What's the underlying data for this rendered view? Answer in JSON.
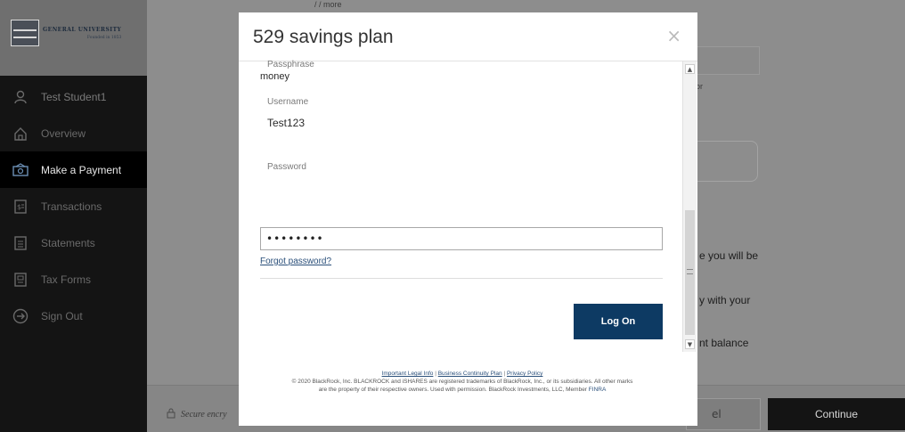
{
  "logo": {
    "name": "GENERAL UNIVERSITY",
    "sub": "Founded in 1853"
  },
  "sidebar": {
    "items": [
      {
        "label": "Test Student1",
        "icon": "user-icon"
      },
      {
        "label": "Overview",
        "icon": "home-icon"
      },
      {
        "label": "Make a Payment",
        "icon": "payment-icon"
      },
      {
        "label": "Transactions",
        "icon": "transactions-icon"
      },
      {
        "label": "Statements",
        "icon": "statements-icon"
      },
      {
        "label": "Tax Forms",
        "icon": "tax-forms-icon"
      },
      {
        "label": "Sign Out",
        "icon": "sign-out-icon"
      }
    ]
  },
  "background": {
    "top_text": "/ / more",
    "text_or": "or",
    "text_line1": "e you will be",
    "text_line2": "y with your",
    "text_line3": "nt balance",
    "secure_text": "Secure encry",
    "cancel_label": "el",
    "continue_label": "Continue"
  },
  "modal": {
    "title": "529 savings plan",
    "close": "×",
    "passphrase_label": "Passphrase",
    "passphrase_value": "money",
    "username_label": "Username",
    "username_value": "Test123",
    "password_label": "Password",
    "password_value": "••••••••",
    "forgot_label": "Forgot password?",
    "logon_label": "Log On",
    "legal_link1": "Important Legal Info",
    "legal_link2": "Business Continuity Plan",
    "legal_link3": "Privacy Policy",
    "legal_sep": "|",
    "legal_line1": "© 2020 BlackRock, Inc. BLACKROCK and iSHARES are registered trademarks of BlackRock, Inc., or its subsidiaries. All other marks",
    "legal_line2": "are the property of their respective owners. Used with permission. BlackRock Investments, LLC, Member",
    "legal_finra": "FINRA"
  }
}
